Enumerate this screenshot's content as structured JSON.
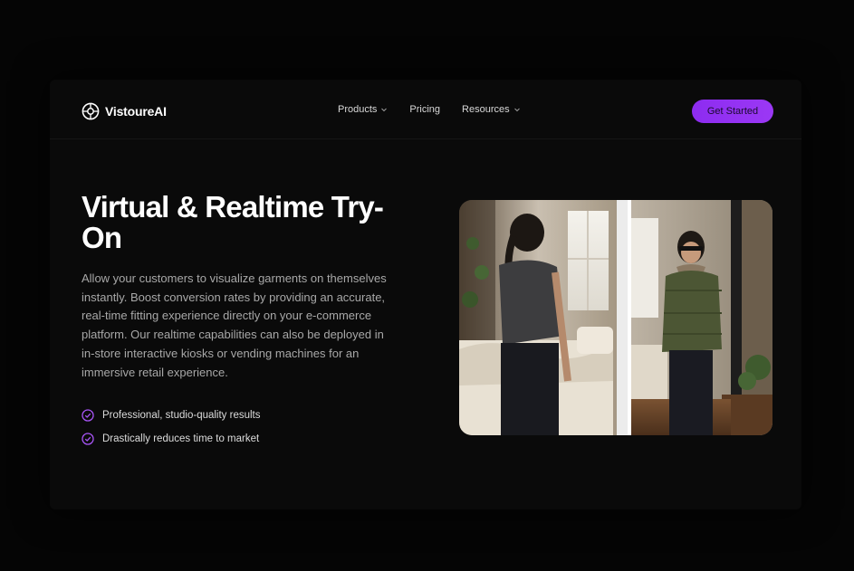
{
  "brand": {
    "name": "VistoureAI",
    "logo_icon": "aperture-icon"
  },
  "nav": {
    "items": [
      {
        "label": "Products",
        "has_dropdown": true
      },
      {
        "label": "Pricing",
        "has_dropdown": false
      },
      {
        "label": "Resources",
        "has_dropdown": true
      }
    ],
    "cta_label": "Get Started"
  },
  "hero": {
    "title": "Virtual & Realtime Try-On",
    "description": "Allow your customers to visualize garments on themselves instantly. Boost conversion rates by providing an accurate, real-time fitting experience directly on your e-commerce platform. Our realtime capabilities can also be deployed in in-store interactive kiosks or vending machines for an immersive retail experience.",
    "features": [
      {
        "label": "Professional, studio-quality results",
        "icon": "check-circle-icon"
      },
      {
        "label": "Drastically reduces time to market",
        "icon": "check-circle-icon"
      }
    ],
    "image_icon": "mirror-try-on-photo"
  },
  "colors": {
    "accent": "#9333ea",
    "background": "#050505",
    "text_primary": "#ffffff",
    "text_muted": "#a8a8a8"
  }
}
